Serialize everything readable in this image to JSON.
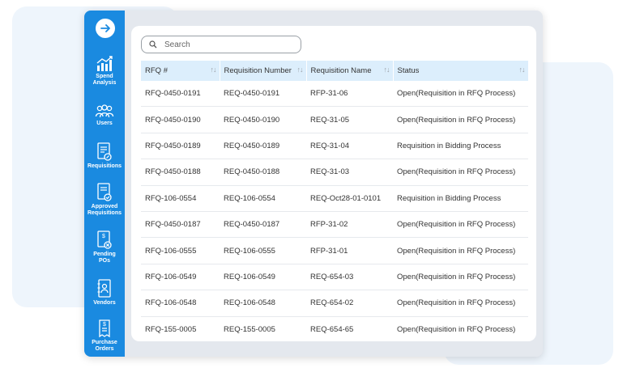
{
  "sidebar": {
    "items": [
      {
        "label": "Spend\nAnalysis",
        "icon": "bar-chart-icon"
      },
      {
        "label": "Users",
        "icon": "users-icon"
      },
      {
        "label": "Requisitions",
        "icon": "requisition-doc-icon"
      },
      {
        "label": "Approved\nRequisitions",
        "icon": "approved-doc-icon"
      },
      {
        "label": "Pending\nPOs",
        "icon": "pending-po-icon"
      },
      {
        "label": "Vendors",
        "icon": "vendor-book-icon"
      },
      {
        "label": "Purchase\nOrders",
        "icon": "purchase-order-icon"
      }
    ]
  },
  "search": {
    "placeholder": "Search"
  },
  "table": {
    "headers": [
      "RFQ #",
      "Requisition Number",
      "Requisition Name",
      "Status"
    ],
    "rows": [
      [
        "RFQ-0450-0191",
        "REQ-0450-0191",
        "RFP-31-06",
        "Open(Requisition in RFQ Process)"
      ],
      [
        "RFQ-0450-0190",
        "REQ-0450-0190",
        "REQ-31-05",
        "Open(Requisition in RFQ Process)"
      ],
      [
        "RFQ-0450-0189",
        "REQ-0450-0189",
        "REQ-31-04",
        "Requisition in Bidding Process"
      ],
      [
        "RFQ-0450-0188",
        "REQ-0450-0188",
        "REQ-31-03",
        "Open(Requisition in RFQ Process)"
      ],
      [
        "RFQ-106-0554",
        "REQ-106-0554",
        "REQ-Oct28-01-0101",
        "Requisition in Bidding Process"
      ],
      [
        "RFQ-0450-0187",
        "REQ-0450-0187",
        "RFP-31-02",
        "Open(Requisition in RFQ Process)"
      ],
      [
        "RFQ-106-0555",
        "REQ-106-0555",
        "RFP-31-01",
        "Open(Requisition in RFQ Process)"
      ],
      [
        "RFQ-106-0549",
        "REQ-106-0549",
        "REQ-654-03",
        "Open(Requisition in RFQ Process)"
      ],
      [
        "RFQ-106-0548",
        "REQ-106-0548",
        "REQ-654-02",
        "Open(Requisition in RFQ Process)"
      ],
      [
        "RFQ-155-0005",
        "REQ-155-0005",
        "REQ-654-65",
        "Open(Requisition in RFQ Process)"
      ]
    ]
  },
  "colors": {
    "sidebar": "#1a8ae0",
    "header_bg": "#dceefc",
    "panel_bg": "#e4e8ee"
  }
}
